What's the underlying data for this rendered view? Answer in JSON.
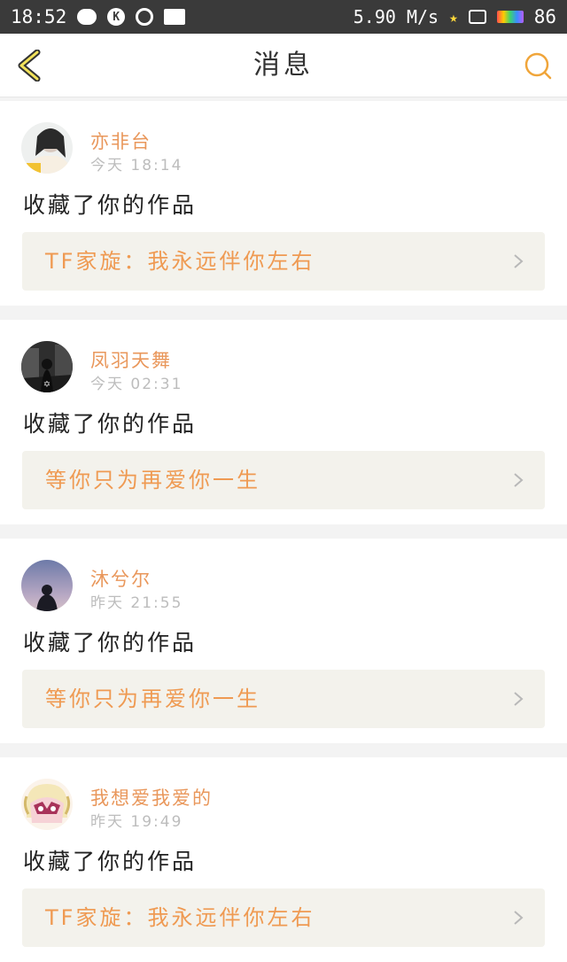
{
  "status_bar": {
    "time": "18:52",
    "speed": "5.90 M/s",
    "battery": "86"
  },
  "nav": {
    "title": "消息",
    "back_icon": "chevron-left-icon",
    "search_icon": "search-icon",
    "accent_color": "#f0a53a"
  },
  "messages": [
    {
      "username": "亦非台",
      "time": "今天 18:14",
      "action": "收藏了你的作品",
      "work_title": "TF家旋：我永远伴你左右",
      "avatar": "avatar-girl-light"
    },
    {
      "username": "凤羽天舞",
      "time": "今天 02:31",
      "action": "收藏了你的作品",
      "work_title": "等你只为再爱你一生",
      "avatar": "avatar-dark-street"
    },
    {
      "username": "沐兮尔",
      "time": "昨天 21:55",
      "action": "收藏了你的作品",
      "work_title": "等你只为再爱你一生",
      "avatar": "avatar-silhouette-sky"
    },
    {
      "username": "我想爱我爱的",
      "time": "昨天 19:49",
      "action": "收藏了你的作品",
      "work_title": "TF家旋：我永远伴你左右",
      "avatar": "avatar-anime"
    }
  ]
}
